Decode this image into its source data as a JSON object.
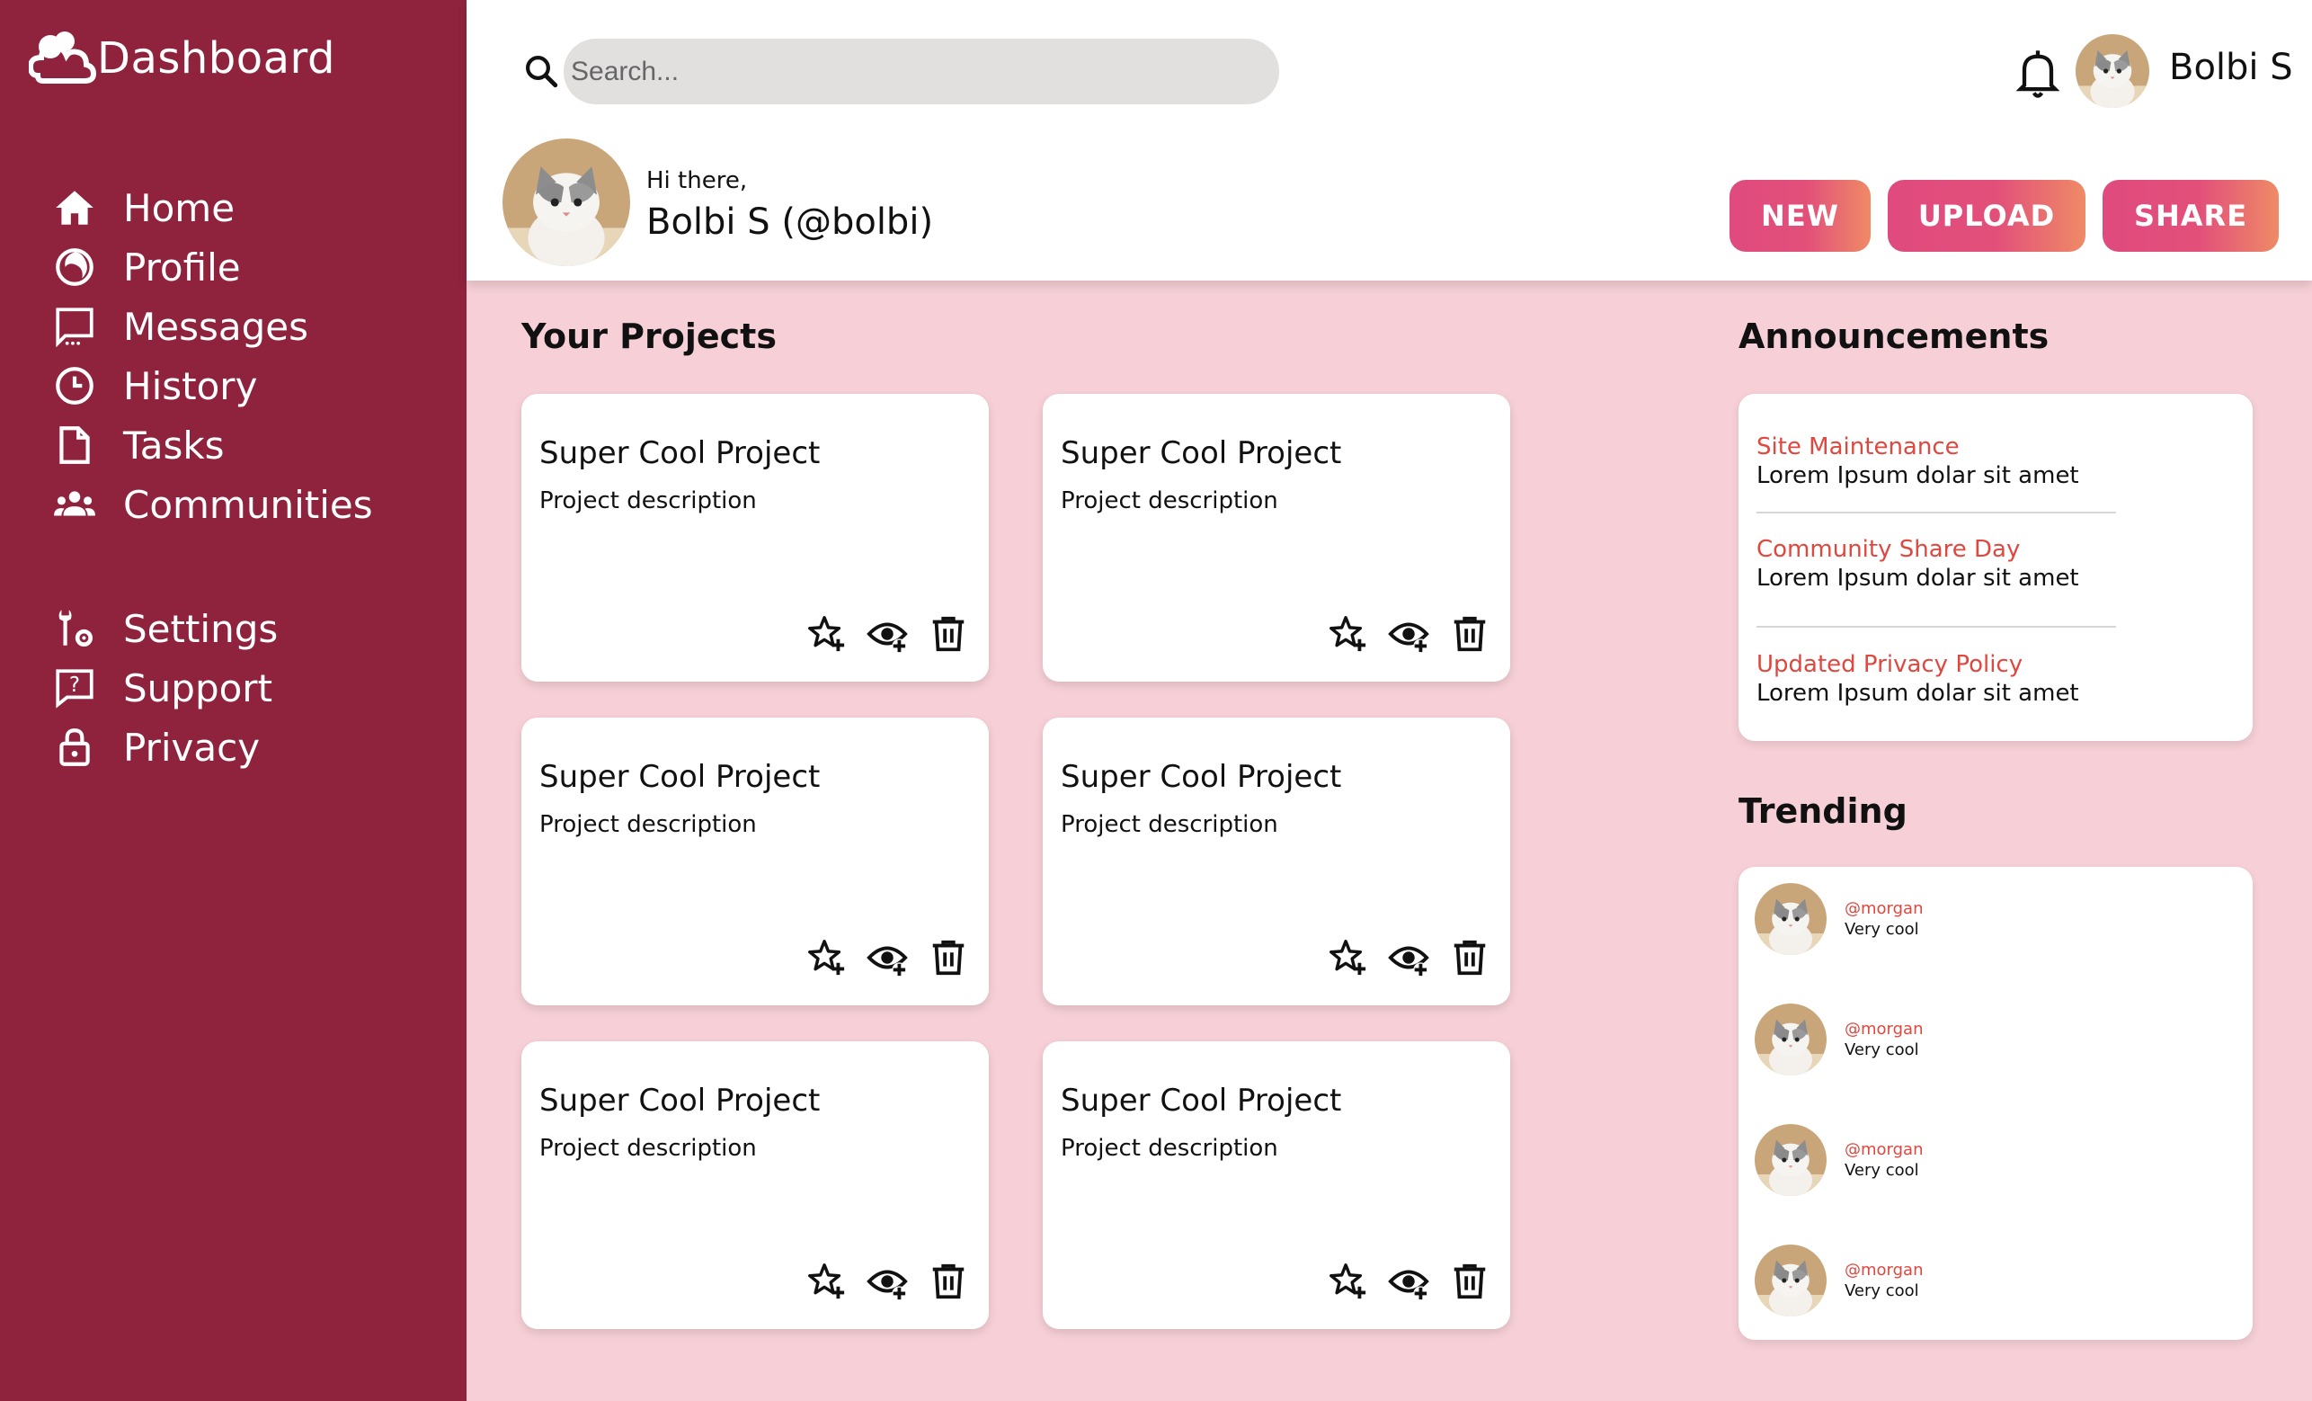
{
  "brand": {
    "title": "Dashboard"
  },
  "sidebar": {
    "items": [
      {
        "label": "Home",
        "icon": "home-icon"
      },
      {
        "label": "Profile",
        "icon": "profile-icon"
      },
      {
        "label": "Messages",
        "icon": "messages-icon"
      },
      {
        "label": "History",
        "icon": "history-icon"
      },
      {
        "label": "Tasks",
        "icon": "tasks-icon"
      },
      {
        "label": "Communities",
        "icon": "communities-icon"
      }
    ],
    "secondary": [
      {
        "label": "Settings",
        "icon": "settings-icon"
      },
      {
        "label": "Support",
        "icon": "support-icon"
      },
      {
        "label": "Privacy",
        "icon": "privacy-icon"
      }
    ]
  },
  "header": {
    "search_placeholder": "Search...",
    "user_name": "Bolbi S"
  },
  "greeting": {
    "hi": "Hi there,",
    "name": "Bolbi S (@bolbi)"
  },
  "actions": {
    "new_label": "NEW",
    "upload_label": "UPLOAD",
    "share_label": "SHARE"
  },
  "projects": {
    "title": "Your Projects",
    "items": [
      {
        "title": "Super Cool Project",
        "description": "Project description"
      },
      {
        "title": "Super Cool Project",
        "description": "Project description"
      },
      {
        "title": "Super Cool Project",
        "description": "Project description"
      },
      {
        "title": "Super Cool Project",
        "description": "Project description"
      },
      {
        "title": "Super Cool Project",
        "description": "Project description"
      },
      {
        "title": "Super Cool Project",
        "description": "Project description"
      }
    ]
  },
  "announcements": {
    "title": "Announcements",
    "items": [
      {
        "title": "Site Maintenance",
        "body": "Lorem Ipsum dolar sit amet"
      },
      {
        "title": "Community Share Day",
        "body": "Lorem Ipsum dolar sit amet"
      },
      {
        "title": "Updated Privacy Policy",
        "body": "Lorem Ipsum dolar sit amet"
      }
    ]
  },
  "trending": {
    "title": "Trending",
    "items": [
      {
        "user": "@morgan",
        "message": "Very cool"
      },
      {
        "user": "@morgan",
        "message": "Very cool"
      },
      {
        "user": "@morgan",
        "message": "Very cool"
      },
      {
        "user": "@morgan",
        "message": "Very cool"
      }
    ]
  },
  "colors": {
    "sidebar_bg": "#8f233d",
    "main_bg": "#f6d0d6",
    "accent_red": "#e0473f",
    "button_gradient_start": "#e04a7e",
    "button_gradient_end": "#ef8a66"
  }
}
